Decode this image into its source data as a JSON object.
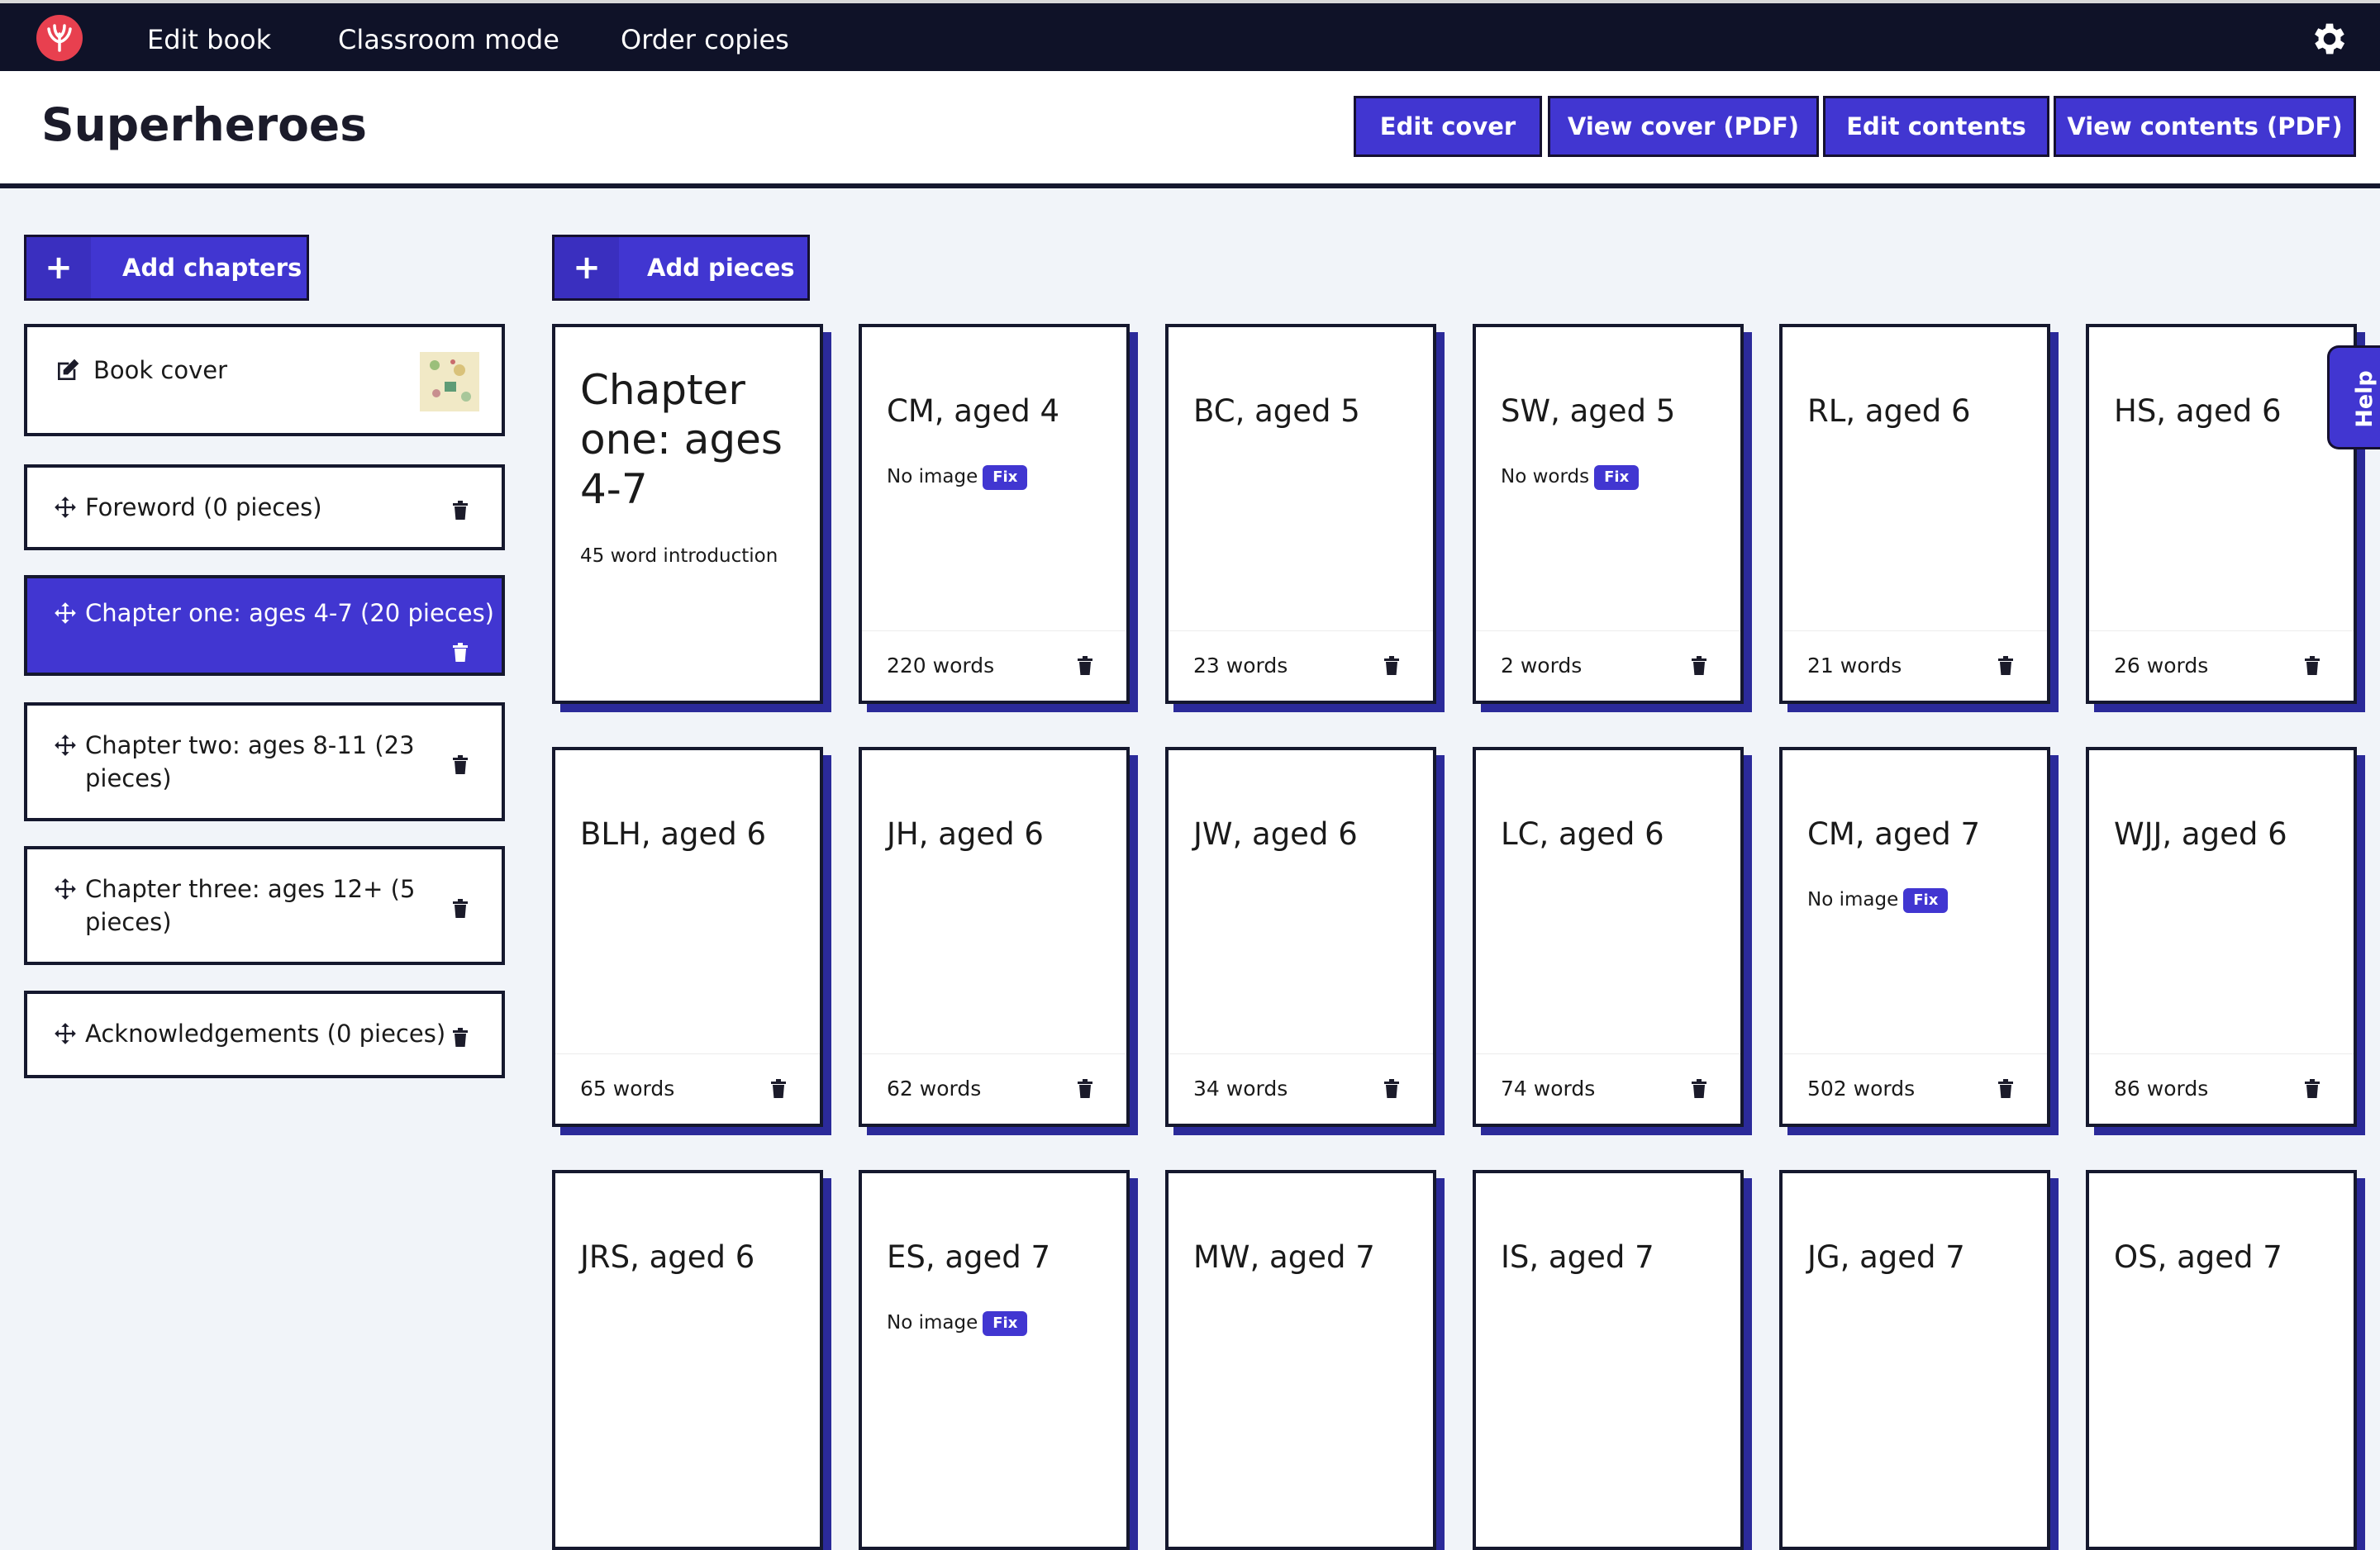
{
  "nav": {
    "items": [
      "Edit book",
      "Classroom mode",
      "Order copies"
    ]
  },
  "header": {
    "title": "Superheroes",
    "buttons": [
      "Edit cover",
      "View cover (PDF)",
      "Edit contents",
      "View contents (PDF)"
    ]
  },
  "sidebar": {
    "add_label": "Add chapters",
    "book_cover_label": "Book cover",
    "chapters": [
      "Foreword (0 pieces)",
      "Chapter one: ages 4-7 (20 pieces)",
      "Chapter two: ages 8-11 (23 pieces)",
      "Chapter three: ages 12+ (5 pieces)",
      "Acknowledgements (0 pieces)"
    ],
    "active_index": 1
  },
  "main": {
    "add_label": "Add pieces",
    "intro_card": {
      "title": "Chapter one: ages 4-7",
      "subtitle": "45 word introduction"
    },
    "pieces": [
      {
        "title": "CM, aged 4",
        "words": "220 words",
        "warning": "No image",
        "fix": "Fix"
      },
      {
        "title": "BC, aged 5",
        "words": "23 words"
      },
      {
        "title": "SW, aged 5",
        "words": "2 words",
        "warning": "No words",
        "fix": "Fix"
      },
      {
        "title": "RL, aged 6",
        "words": "21 words"
      },
      {
        "title": "HS, aged 6",
        "words": "26 words"
      },
      {
        "title": "BLH, aged 6",
        "words": "65 words"
      },
      {
        "title": "JH, aged 6",
        "words": "62 words"
      },
      {
        "title": "JW, aged 6",
        "words": "34 words"
      },
      {
        "title": "LC, aged 6",
        "words": "74 words"
      },
      {
        "title": "CM, aged 7",
        "words": "502 words",
        "warning": "No image",
        "fix": "Fix"
      },
      {
        "title": "WJJ, aged 6",
        "words": "86 words"
      },
      {
        "title": "JRS, aged 6"
      },
      {
        "title": "ES, aged 7",
        "warning": "No image",
        "fix": "Fix"
      },
      {
        "title": "MW, aged 7"
      },
      {
        "title": "IS, aged 7"
      },
      {
        "title": "JG, aged 7"
      },
      {
        "title": "OS, aged 7"
      }
    ]
  },
  "help": {
    "label": "Help"
  },
  "colors": {
    "accent": "#4136d1",
    "dark": "#0f1228",
    "logo": "#e8404f"
  }
}
